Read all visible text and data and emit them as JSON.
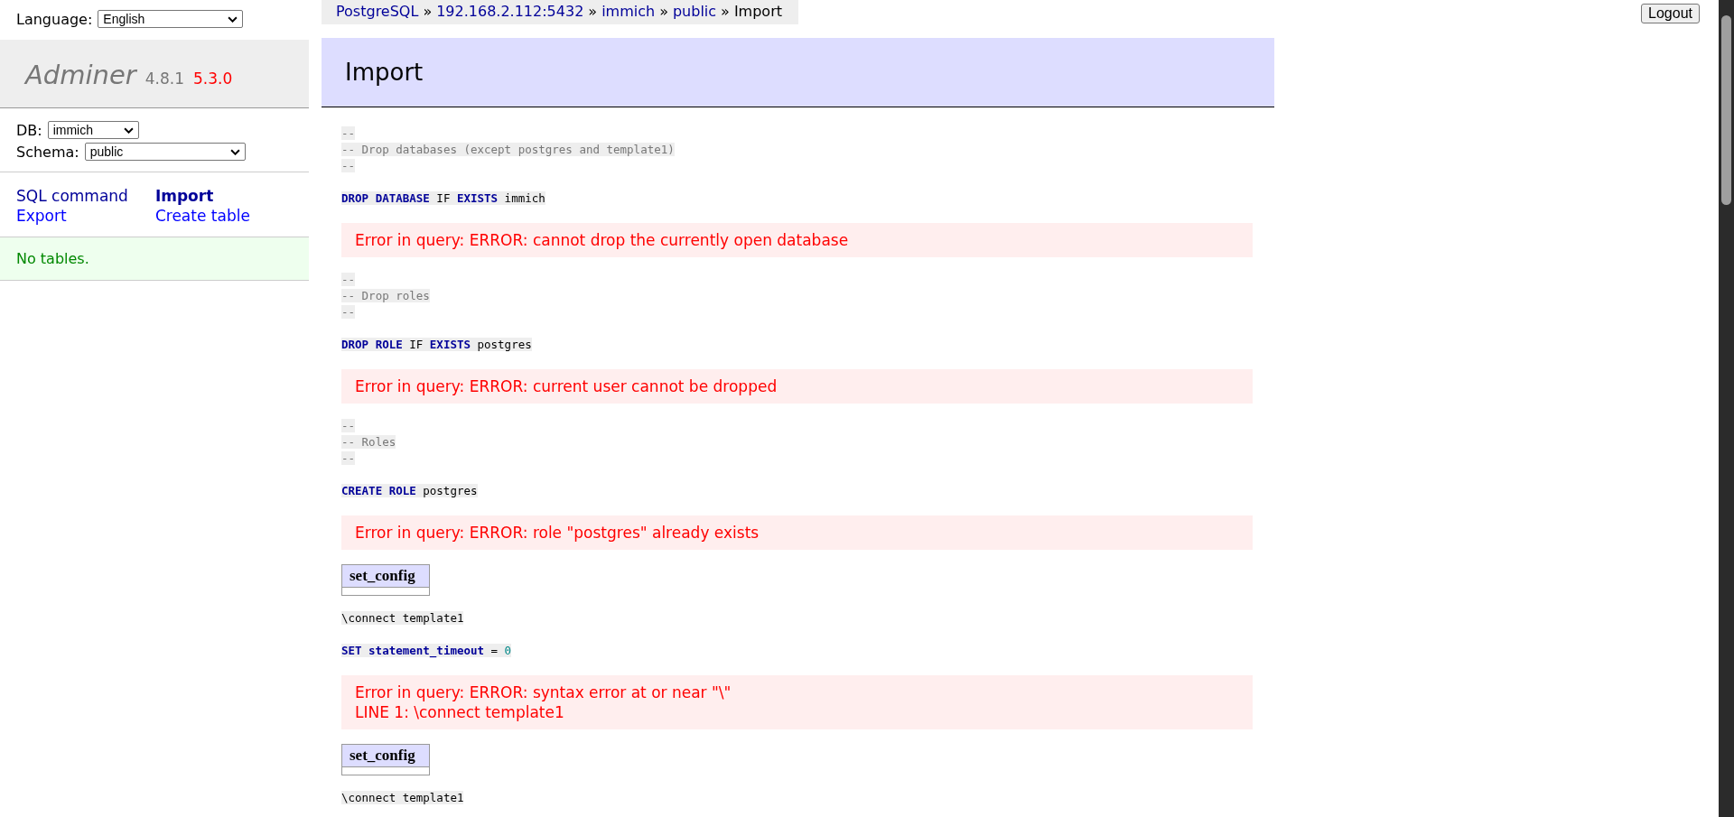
{
  "language": {
    "label": "Language:",
    "value": "English"
  },
  "logo": {
    "name": "Adminer",
    "version": "4.8.1",
    "new_version": "5.3.0"
  },
  "db": {
    "label": "DB:",
    "value": "immich"
  },
  "schema": {
    "label": "Schema:",
    "value": "public"
  },
  "links": [
    {
      "label": "SQL command",
      "selected": false
    },
    {
      "label": "Import",
      "selected": true
    },
    {
      "label": "Export",
      "selected": false
    },
    {
      "label": "Create table",
      "selected": false
    }
  ],
  "tables_message": "No tables.",
  "breadcrumb": [
    {
      "label": "PostgreSQL",
      "kind": "link"
    },
    {
      "label": "»",
      "kind": "separator"
    },
    {
      "label": "192.168.2.112:5432",
      "kind": "link"
    },
    {
      "label": "»",
      "kind": "separator"
    },
    {
      "label": "immich",
      "kind": "link"
    },
    {
      "label": "»",
      "kind": "separator"
    },
    {
      "label": "public",
      "kind": "link"
    },
    {
      "label": "»",
      "kind": "separator"
    },
    {
      "label": "Import",
      "kind": "current"
    }
  ],
  "logout": "Logout",
  "heading": "Import",
  "log": [
    {
      "kind": "comment",
      "lines": [
        "--",
        "-- Drop databases (except postgres and template1)",
        "--"
      ]
    },
    {
      "kind": "sql",
      "tokens": [
        {
          "text": "DROP",
          "kind": "keyword"
        },
        {
          "text": "DATABASE",
          "kind": "keyword"
        },
        {
          "text": "IF",
          "kind": "plain"
        },
        {
          "text": "EXISTS",
          "kind": "keyword"
        },
        {
          "text": "immich",
          "kind": "plain"
        }
      ]
    },
    {
      "kind": "error",
      "lines": [
        "Error in query: ERROR: cannot drop the currently open database"
      ]
    },
    {
      "kind": "comment",
      "lines": [
        "--",
        "-- Drop roles",
        "--"
      ]
    },
    {
      "kind": "sql",
      "tokens": [
        {
          "text": "DROP",
          "kind": "keyword"
        },
        {
          "text": "ROLE",
          "kind": "keyword"
        },
        {
          "text": "IF",
          "kind": "plain"
        },
        {
          "text": "EXISTS",
          "kind": "keyword"
        },
        {
          "text": "postgres",
          "kind": "plain"
        }
      ]
    },
    {
      "kind": "error",
      "lines": [
        "Error in query: ERROR: current user cannot be dropped"
      ]
    },
    {
      "kind": "comment",
      "lines": [
        "--",
        "-- Roles",
        "--"
      ]
    },
    {
      "kind": "sql",
      "tokens": [
        {
          "text": "CREATE",
          "kind": "keyword"
        },
        {
          "text": "ROLE",
          "kind": "keyword"
        },
        {
          "text": "postgres",
          "kind": "plain"
        }
      ]
    },
    {
      "kind": "error",
      "lines": [
        "Error in query: ERROR: role \"postgres\" already exists"
      ]
    },
    {
      "kind": "result",
      "columns": [
        "set_config"
      ]
    },
    {
      "kind": "sql",
      "tokens": [
        {
          "text": "\\connect",
          "kind": "plain"
        },
        {
          "text": "template1",
          "kind": "plain"
        }
      ]
    },
    {
      "kind": "sql",
      "tokens": [
        {
          "text": "SET",
          "kind": "keyword"
        },
        {
          "text": "statement_timeout",
          "kind": "keyword"
        },
        {
          "text": "=",
          "kind": "plain"
        },
        {
          "text": "0",
          "kind": "number"
        }
      ]
    },
    {
      "kind": "error",
      "lines": [
        "Error in query: ERROR: syntax error at or near \"\\\"",
        "LINE 1: \\connect template1"
      ]
    },
    {
      "kind": "result",
      "columns": [
        "set_config"
      ]
    },
    {
      "kind": "sql",
      "tokens": [
        {
          "text": "\\connect",
          "kind": "plain"
        },
        {
          "text": "template1",
          "kind": "plain"
        }
      ]
    }
  ]
}
